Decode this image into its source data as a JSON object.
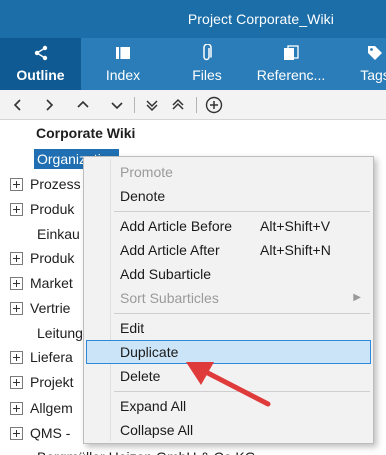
{
  "window": {
    "title": "Project Corporate_Wiki"
  },
  "tabs": [
    {
      "label": "Outline",
      "icon": "share-icon",
      "active": true
    },
    {
      "label": "Index",
      "icon": "book-icon",
      "active": false
    },
    {
      "label": "Files",
      "icon": "paperclip-icon",
      "active": false
    },
    {
      "label": "Referenc...",
      "icon": "references-icon",
      "active": false
    },
    {
      "label": "Tags",
      "icon": "tag-icon",
      "active": false
    }
  ],
  "toolbar": {
    "buttons": [
      "move-left-icon",
      "move-right-icon",
      "move-up-icon",
      "move-down-icon",
      "expand-all-icon",
      "collapse-all-icon",
      "add-circle-icon"
    ]
  },
  "tree": {
    "root": "Corporate Wiki",
    "selected": "Organization",
    "items": [
      {
        "label": "Prozess",
        "expandable": true
      },
      {
        "label": "Produk",
        "expandable": true
      },
      {
        "label": "Einkau",
        "expandable": false
      },
      {
        "label": "Produk",
        "expandable": true
      },
      {
        "label": "Market",
        "expandable": true
      },
      {
        "label": "Vertrie",
        "expandable": true
      },
      {
        "label": "Leitung",
        "expandable": false
      },
      {
        "label": "Liefera",
        "expandable": true
      },
      {
        "label": "Projekt",
        "expandable": true
      },
      {
        "label": "Allgem",
        "expandable": true
      },
      {
        "label": "QMS -",
        "expandable": true
      }
    ],
    "cut_off_text": "Bergmüller Heizen GmbH & Co KG"
  },
  "context_menu": {
    "promote": "Promote",
    "denote": "Denote",
    "add_before": "Add Article Before",
    "add_before_shortcut": "Alt+Shift+V",
    "add_after": "Add Article After",
    "add_after_shortcut": "Alt+Shift+N",
    "add_sub": "Add Subarticle",
    "sort_sub": "Sort Subarticles",
    "edit": "Edit",
    "duplicate": "Duplicate",
    "delete": "Delete",
    "expand_all": "Expand All",
    "collapse_all": "Collapse All"
  },
  "colors": {
    "titlebar": "#1b6ea8",
    "tabbar": "#2a7db8",
    "active_tab": "#0f5a92",
    "selection": "#1f6fb2",
    "menu_highlight": "#cce4f7",
    "arrow": "#e03b3b"
  }
}
